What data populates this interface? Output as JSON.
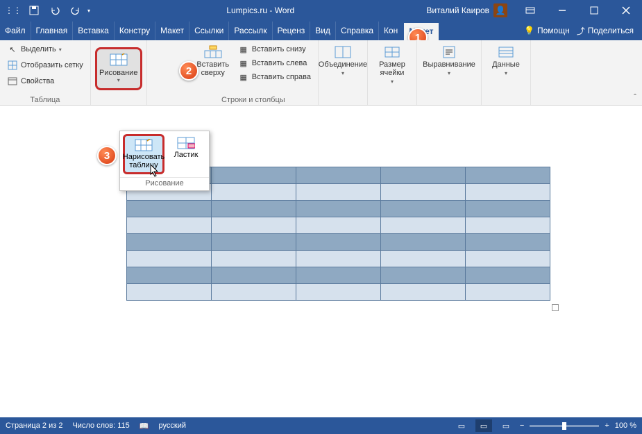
{
  "title": "Lumpics.ru - Word",
  "user_name": "Виталий Каиров",
  "menu": [
    "Файл",
    "Главная",
    "Вставка",
    "Констру",
    "Макет",
    "Ссылки",
    "Рассылк",
    "Реценз",
    "Вид",
    "Справка",
    "Кон",
    "",
    "Макет"
  ],
  "menu_right": {
    "help": "Помощн",
    "share": "Поделиться"
  },
  "ribbon": {
    "table_group": {
      "select": "Выделить",
      "grid": "Отобразить сетку",
      "props": "Свойства",
      "label": "Таблица"
    },
    "drawing": {
      "label": "Рисование"
    },
    "insert": {
      "above": "Вставить сверху",
      "below": "Вставить снизу",
      "left": "Вставить слева",
      "right": "Вставить справа",
      "label": "Строки и столбцы"
    },
    "merge": {
      "label": "Объединение"
    },
    "cellsize": {
      "label": "Размер ячейки"
    },
    "align": {
      "label": "Выравнивание"
    },
    "data": {
      "label": "Данные"
    }
  },
  "popup": {
    "draw_table": "Нарисовать таблицу",
    "eraser": "Ластик",
    "label": "Рисование"
  },
  "callouts": [
    "1",
    "2",
    "3"
  ],
  "status": {
    "page": "Страница 2 из 2",
    "words": "Число слов: 115",
    "lang": "русский",
    "zoom": "100 %"
  }
}
